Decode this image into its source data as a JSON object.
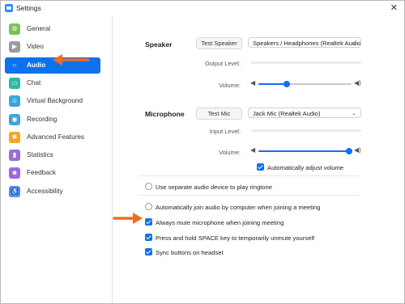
{
  "window": {
    "title": "Settings",
    "close_glyph": "✕"
  },
  "colors": {
    "accent": "#0e72ed",
    "arrow": "#f26b21"
  },
  "sidebar": {
    "items": [
      {
        "label": "General",
        "icon": "gear-icon",
        "glyph": "⚙",
        "color": "#7fbf5a",
        "active": false
      },
      {
        "label": "Video",
        "icon": "video-camera-icon",
        "glyph": "▶",
        "color": "#9b9b9b",
        "active": false
      },
      {
        "label": "Audio",
        "icon": "headphones-icon",
        "glyph": "∩",
        "color": "#0e72ed",
        "active": true
      },
      {
        "label": "Chat",
        "icon": "chat-bubble-icon",
        "glyph": "▭",
        "color": "#2fb9a3",
        "active": false
      },
      {
        "label": "Virtual Background",
        "icon": "person-background-icon",
        "glyph": "☺",
        "color": "#3aa7d8",
        "active": false
      },
      {
        "label": "Recording",
        "icon": "record-icon",
        "glyph": "◉",
        "color": "#3aa7d8",
        "active": false
      },
      {
        "label": "Advanced Features",
        "icon": "advanced-settings-icon",
        "glyph": "✱",
        "color": "#f5a623",
        "active": false
      },
      {
        "label": "Statistics",
        "icon": "statistics-icon",
        "glyph": "▮",
        "color": "#9b6cd8",
        "active": false
      },
      {
        "label": "Feedback",
        "icon": "feedback-icon",
        "glyph": "☻",
        "color": "#9b6cd8",
        "active": false
      },
      {
        "label": "Accessibility",
        "icon": "accessibility-icon",
        "glyph": "♿",
        "color": "#5b8def",
        "active": false
      }
    ]
  },
  "speaker": {
    "label": "Speaker",
    "test_button": "Test Speaker",
    "device": "Speakers / Headphones (Realtek Audio",
    "output_level_label": "Output Level:",
    "volume_label": "Volume:",
    "volume": 0.3
  },
  "microphone": {
    "label": "Microphone",
    "test_button": "Test Mic",
    "device": "Jack Mic (Realtek Audio)",
    "input_level_label": "Input Level:",
    "volume_label": "Volume:",
    "volume": 0.97,
    "auto_adjust_label": "Automatically adjust volume",
    "auto_adjust_checked": true
  },
  "options": {
    "separate_device": {
      "label": "Use separate audio device to play ringtone",
      "checked": false
    },
    "auto_join": {
      "label": "Automatically join audio by computer when joining a meeting",
      "checked": false
    },
    "always_mute": {
      "label": "Always mute microphone when joining meeting",
      "checked": true
    },
    "space_unmute": {
      "label": "Press and hold SPACE key to temporarily unmute yourself",
      "checked": true
    },
    "sync_headset": {
      "label": "Sync buttons on headset",
      "checked": true
    }
  }
}
